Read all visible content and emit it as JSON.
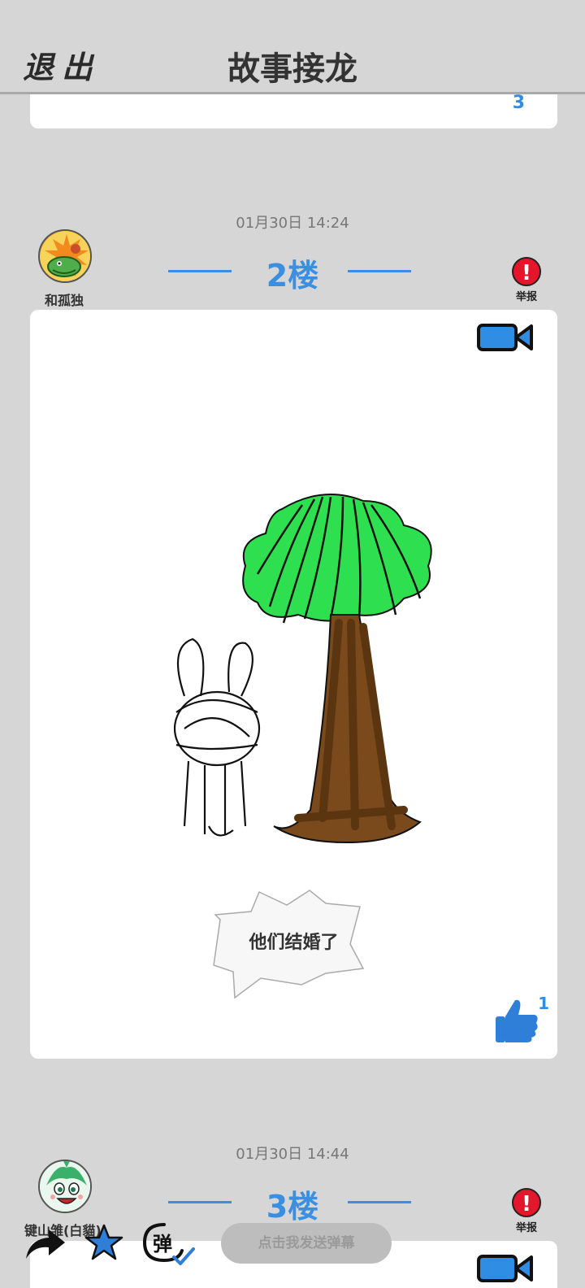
{
  "header": {
    "exit_label": "退出",
    "title": "故事接龙"
  },
  "prev_card": {
    "count": "3"
  },
  "posts": [
    {
      "time": "01月30日  14:24",
      "username": "和孤独",
      "floor": "2楼",
      "report_label": "举报",
      "caption": "他们结婚了",
      "likes": "1"
    },
    {
      "time": "01月30日  14:44",
      "username": "键山雏(白貓)",
      "floor": "3楼",
      "report_label": "举报"
    }
  ],
  "toolbar": {
    "danmaku_icon_text": "弹",
    "danmaku_placeholder": "点击我发送弹幕"
  },
  "icons": [
    "share-icon",
    "favorite-star-icon",
    "danmaku-icon",
    "video-icon",
    "thumbs-up-icon",
    "report-icon"
  ],
  "colors": {
    "accent": "#3b8fe0",
    "report": "#e5162b",
    "background": "#d6d6d6"
  }
}
